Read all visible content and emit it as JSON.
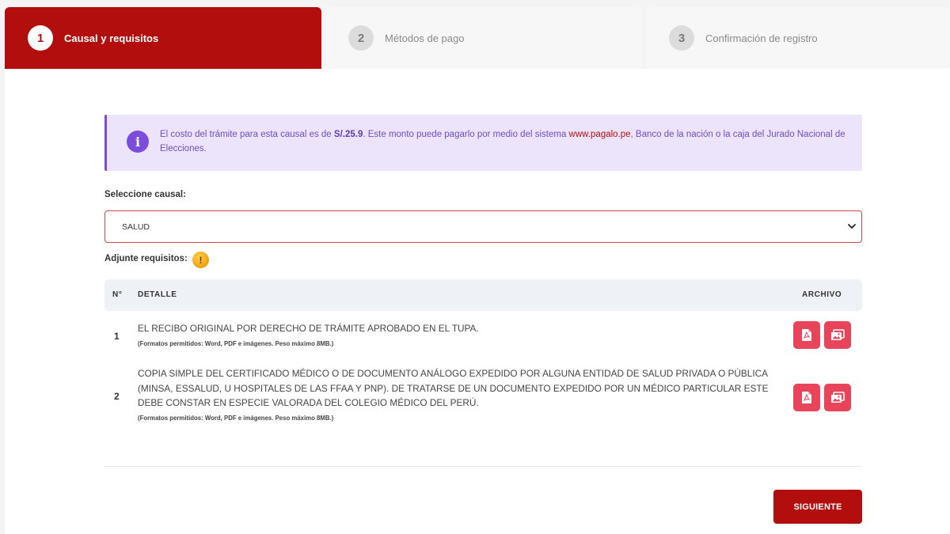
{
  "steps": [
    {
      "number": "1",
      "label": "Causal y requisitos",
      "active": true
    },
    {
      "number": "2",
      "label": "Métodos de pago",
      "active": false
    },
    {
      "number": "3",
      "label": "Confirmación de registro",
      "active": false
    }
  ],
  "alert": {
    "icon": "info-icon",
    "text_before": "El costo del trámite para esta causal es de ",
    "amount": "S/.25.9",
    "text_mid": ". Este monto puede pagarlo por medio del sistema ",
    "link": "www.pagalo.pe",
    "text_after": ", Banco de la nación o la caja del Jurado Nacional de Elecciones.",
    "colors": {
      "background": "#ece4fb",
      "accent": "#7c4ddc",
      "link": "#b30e0e"
    }
  },
  "causal": {
    "label": "Seleccione causal:",
    "selected": "SALUD"
  },
  "requirements": {
    "label": "Adjunte requisitos:",
    "warning_icon": "!",
    "columns": {
      "number": "N°",
      "detail": "DETALLE",
      "file": "ARCHIVO"
    },
    "rows": [
      {
        "number": "1",
        "detail": "EL RECIBO ORIGINAL POR DERECHO DE TRÁMITE APROBADO EN EL TUPA.",
        "formats": "(Formatos permitidos: Word, PDF e imágenes. Peso máximo 8MB.)"
      },
      {
        "number": "2",
        "detail": "COPIA SIMPLE DEL CERTIFICADO MÉDICO O DE DOCUMENTO ANÁLOGO EXPEDIDO POR ALGUNA ENTIDAD DE SALUD PRIVADA O PÚBLICA (MINSA, ESSALUD, U HOSPITALES DE LAS FFAA Y PNP). DE TRATARSE DE UN DOCUMENTO EXPEDIDO POR UN MÉDICO PARTICULAR ESTE DEBE CONSTAR EN ESPECIE VALORADA DEL COLEGIO MÉDICO DEL PERÚ.",
        "formats": "(Formatos permitidos: Word, PDF e imágenes. Peso máximo 8MB.)"
      }
    ]
  },
  "actions": {
    "next_label": "SIGUIENTE"
  },
  "colors": {
    "brand": "#b30e0e",
    "file_button": "#e8445a"
  }
}
